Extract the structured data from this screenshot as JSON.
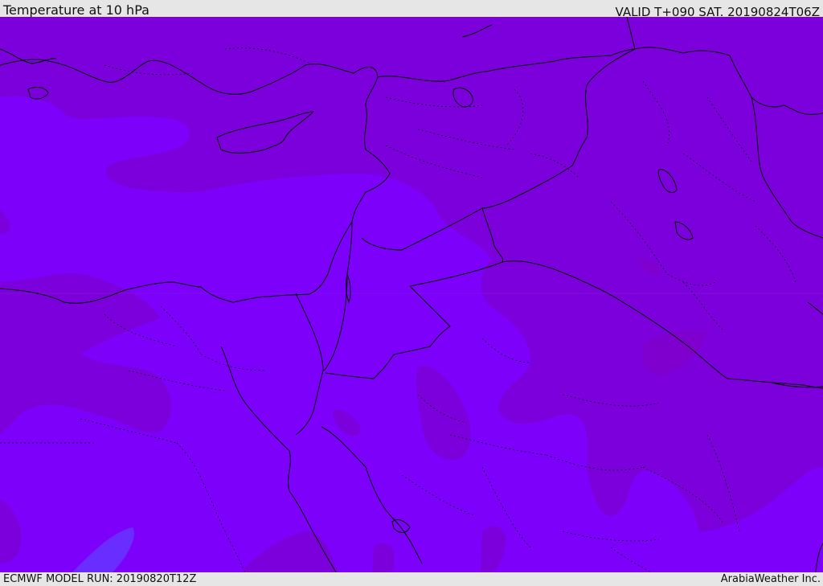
{
  "header": {
    "title": "Temperature at 10 hPa",
    "valid": "VALID T+090 SAT. 20190824T06Z"
  },
  "footer": {
    "model_run": "ECMWF MODEL RUN: 20190820T12Z",
    "credit": "ArabiaWeather Inc."
  },
  "colors": {
    "base_field": "#7c00db",
    "warm_field": "#7d00fb",
    "cool_patch": "#8800cc",
    "blue_patch": "#6a2dff",
    "border_line": "#000000",
    "bar_background": "#e6e6e6"
  }
}
